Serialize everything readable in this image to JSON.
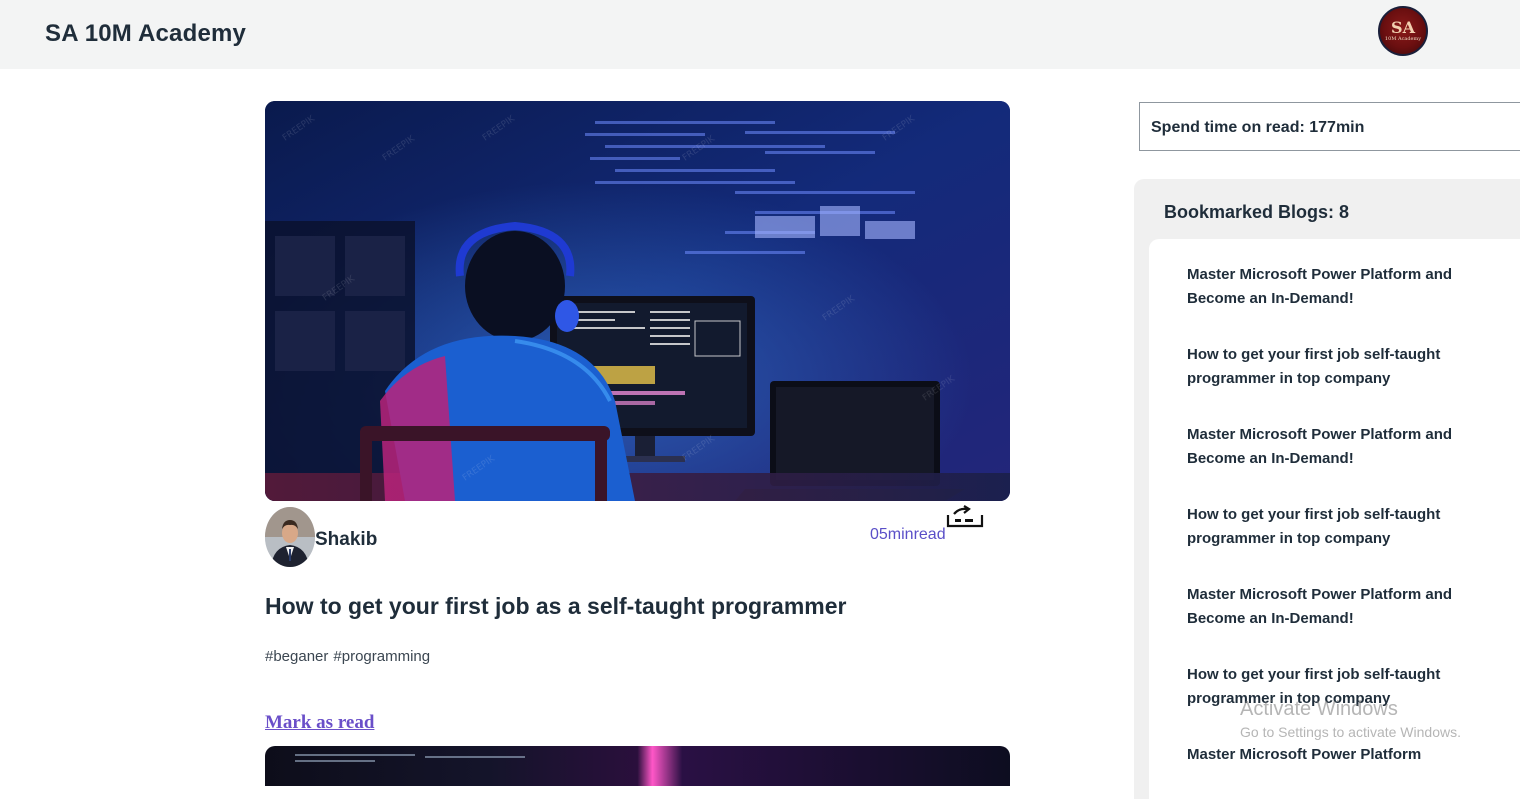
{
  "header": {
    "brand": "SA 10M Academy",
    "logo_text": "SA",
    "logo_subtext": "10M Academy"
  },
  "blog": {
    "author": "Shakib",
    "read_time": "05minread",
    "title": "How to get your first job as a self-taught programmer",
    "tags": [
      "#beganer",
      "#programming"
    ],
    "mark_as_read": "Mark as read",
    "cover_icon": "programmer-at-computer-image",
    "bookmark_icon": "bookmark-icon"
  },
  "sidebar": {
    "spend_time": "Spend time on read: 177min",
    "bookmarks_heading": "Bookmarked Blogs: 8",
    "bookmarks": [
      "Master Microsoft Power Platform and Become an In-Demand!",
      "How to get your first job self-taught programmer in top company",
      "Master Microsoft Power Platform and Become an In-Demand!",
      "How to get your first job self-taught programmer in top company",
      "Master Microsoft Power Platform and Become an In-Demand!",
      "How to get your first job self-taught programmer in top company",
      "Master Microsoft Power Platform"
    ]
  },
  "watermark": {
    "line1": "Activate Windows",
    "line2": "Go to Settings to activate Windows."
  },
  "colors": {
    "header_bg": "#f3f4f4",
    "accent_link": "#6a4fc9",
    "read_time": "#5a4fc8",
    "panel_bg": "#f0f0f0"
  }
}
